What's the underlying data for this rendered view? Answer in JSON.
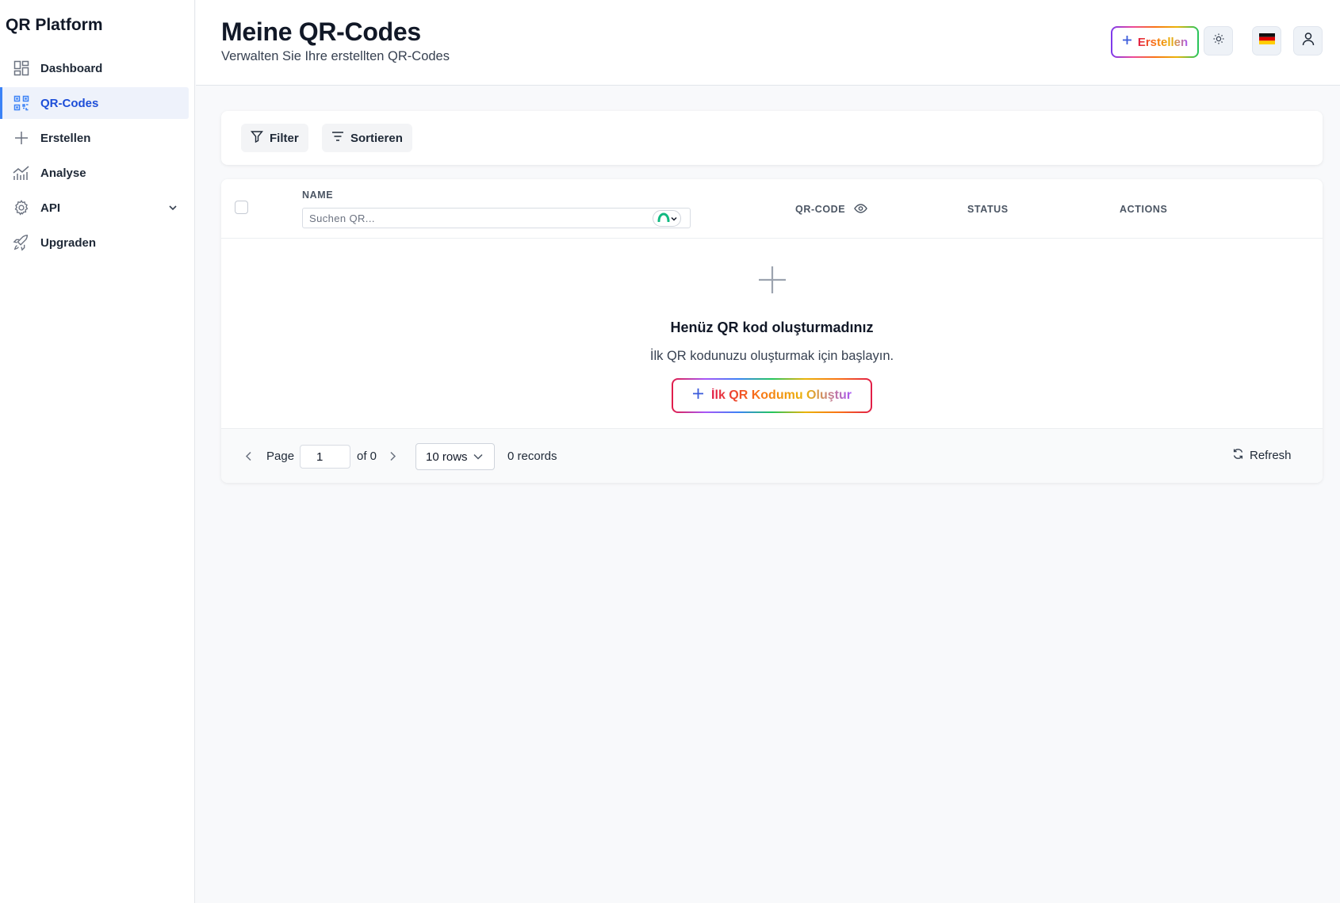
{
  "app": {
    "brand": "QR Platform"
  },
  "sidebar": {
    "items": [
      {
        "label": "Dashboard",
        "icon": "grid-icon",
        "active": false
      },
      {
        "label": "QR-Codes",
        "icon": "qr-code-icon",
        "active": true
      },
      {
        "label": "Erstellen",
        "icon": "plus-icon",
        "active": false
      },
      {
        "label": "Analyse",
        "icon": "chart-icon",
        "active": false
      },
      {
        "label": "API",
        "icon": "gear-icon",
        "active": false,
        "expandable": true
      },
      {
        "label": "Upgraden",
        "icon": "rocket-icon",
        "active": false
      }
    ]
  },
  "header": {
    "title": "Meine QR-Codes",
    "subtitle": "Verwalten Sie Ihre erstellten QR-Codes",
    "create_label": "Erstellen",
    "theme_icon": "sun-icon",
    "language_flag": "german-flag-icon",
    "user_icon": "user-icon"
  },
  "toolbar": {
    "filter_label": "Filter",
    "sort_label": "Sortieren"
  },
  "table": {
    "columns": {
      "name": "NAME",
      "qrcode": "QR-CODE",
      "status": "STATUS",
      "actions": "ACTIONS"
    },
    "search_placeholder": "Suchen QR..."
  },
  "empty_state": {
    "title": "Henüz QR kod oluşturmadınız",
    "text": "İlk QR kodunuzu oluşturmak için başlayın.",
    "button_label": "İlk QR Kodumu Oluştur"
  },
  "pagination": {
    "page_label": "Page",
    "page_value": "1",
    "of_label": "of 0",
    "rows_label": "10 rows",
    "records_label": "0 records",
    "refresh_label": "Refresh"
  },
  "colors": {
    "accent": "#3b82f6",
    "active_bg": "#eef2fb",
    "page_bg": "#f8f9fb"
  }
}
